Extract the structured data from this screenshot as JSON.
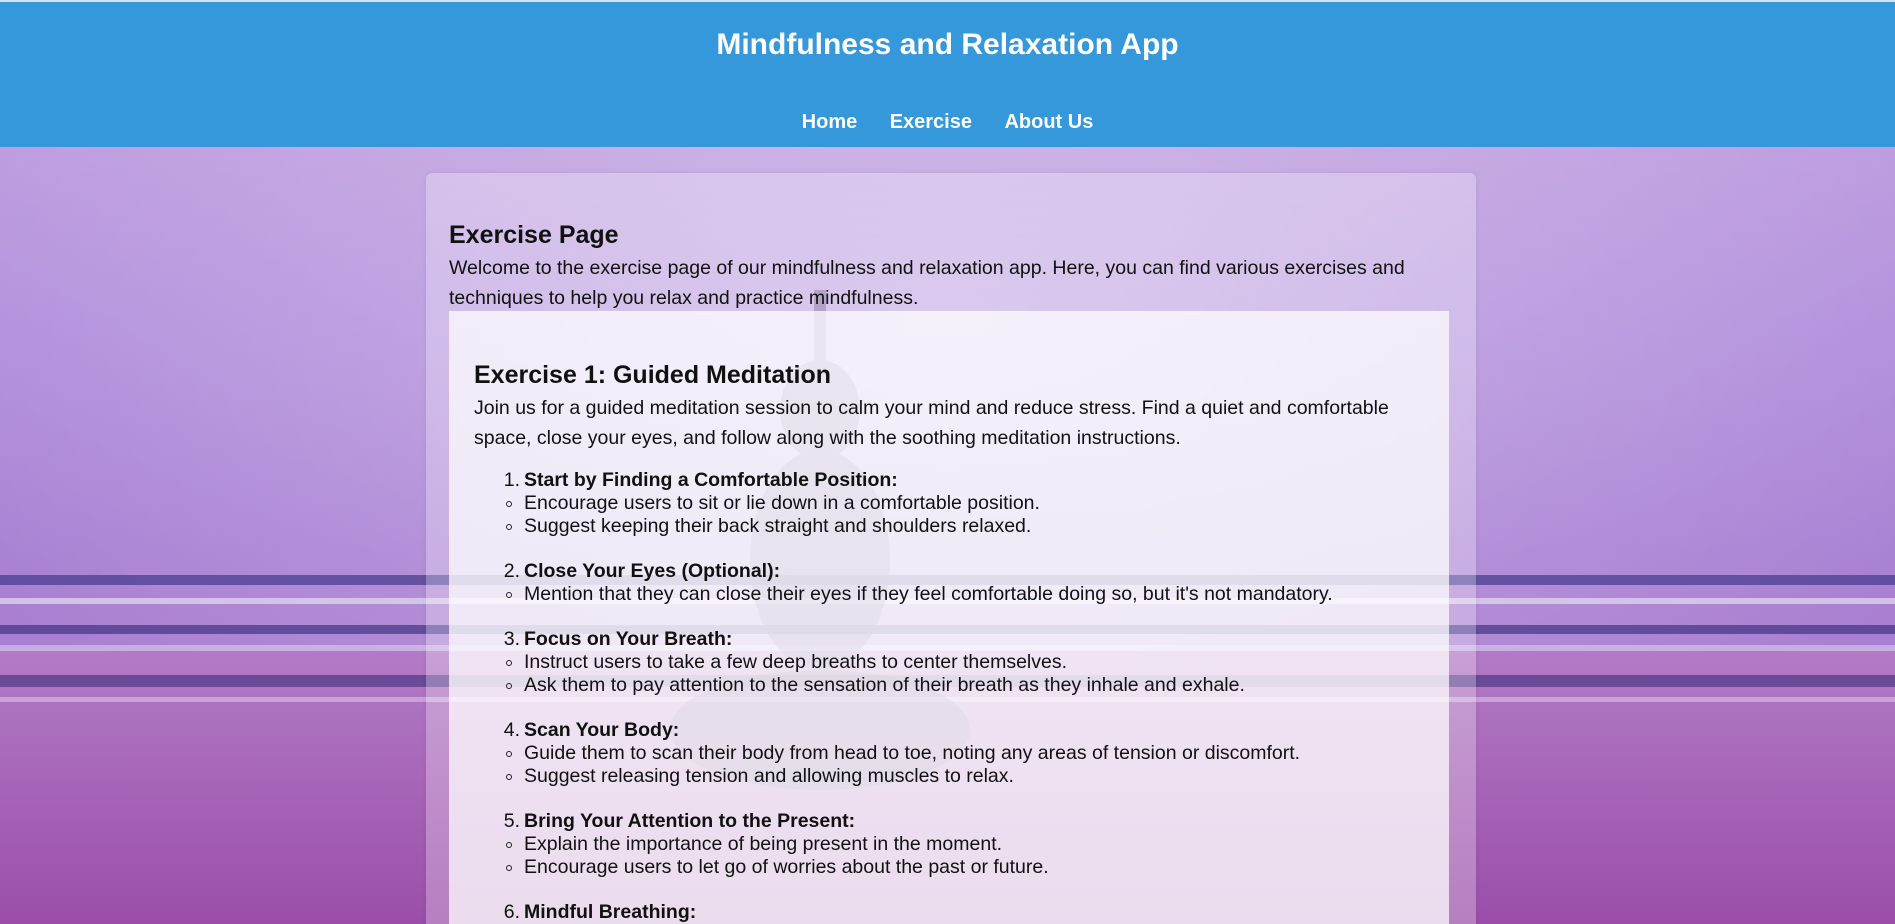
{
  "header": {
    "title": "Mindfulness and Relaxation App",
    "nav": [
      {
        "label": "Home"
      },
      {
        "label": "Exercise"
      },
      {
        "label": "About Us"
      }
    ]
  },
  "page": {
    "heading": "Exercise Page",
    "intro": "Welcome to the exercise page of our mindfulness and relaxation app. Here, you can find various exercises and techniques to help you relax and practice mindfulness."
  },
  "exercise": {
    "title": "Exercise 1: Guided Meditation",
    "description": "Join us for a guided meditation session to calm your mind and reduce stress. Find a quiet and comfortable space, close your eyes, and follow along with the soothing meditation instructions.",
    "steps": [
      {
        "num": "1.",
        "title": "Start by Finding a Comfortable Position:",
        "items": [
          "Encourage users to sit or lie down in a comfortable position.",
          "Suggest keeping their back straight and shoulders relaxed."
        ]
      },
      {
        "num": "2.",
        "title": "Close Your Eyes (Optional):",
        "items": [
          "Mention that they can close their eyes if they feel comfortable doing so, but it's not mandatory."
        ]
      },
      {
        "num": "3.",
        "title": "Focus on Your Breath:",
        "items": [
          "Instruct users to take a few deep breaths to center themselves.",
          "Ask them to pay attention to the sensation of their breath as they inhale and exhale."
        ]
      },
      {
        "num": "4.",
        "title": "Scan Your Body:",
        "items": [
          "Guide them to scan their body from head to toe, noting any areas of tension or discomfort.",
          "Suggest releasing tension and allowing muscles to relax."
        ]
      },
      {
        "num": "5.",
        "title": "Bring Your Attention to the Present:",
        "items": [
          "Explain the importance of being present in the moment.",
          "Encourage users to let go of worries about the past or future."
        ]
      },
      {
        "num": "6.",
        "title": "Mindful Breathing:",
        "items": []
      }
    ]
  },
  "colors": {
    "header_bg": "#3498db",
    "header_text": "#ffffff"
  }
}
